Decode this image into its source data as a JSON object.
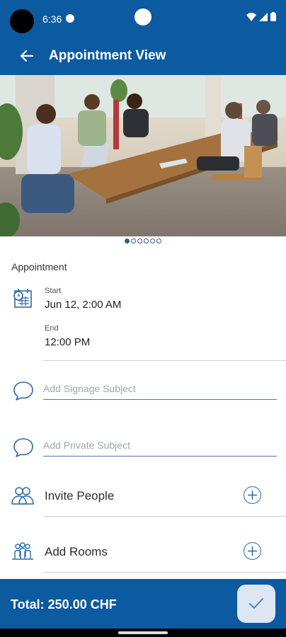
{
  "status_bar": {
    "time": "6:36"
  },
  "app_bar": {
    "title": "Appointment View",
    "back_icon": "arrow-left-icon"
  },
  "carousel": {
    "page_count": 6,
    "current_index": 0
  },
  "appointment": {
    "section_title": "Appointment",
    "start_label": "Start",
    "start_value": "Jun 12, 2:00 AM",
    "end_label": "End",
    "end_value": "12:00 PM"
  },
  "fields": {
    "signage_placeholder": "Add Signage Subject",
    "private_placeholder": "Add Private Subject"
  },
  "actions": {
    "invite_label": "Invite People",
    "rooms_label": "Add Rooms"
  },
  "footer": {
    "total": "Total: 250.00 CHF"
  },
  "colors": {
    "primary": "#0c5aa0",
    "accent_line": "#4a79ad",
    "confirm_bg": "#dde7f4"
  }
}
